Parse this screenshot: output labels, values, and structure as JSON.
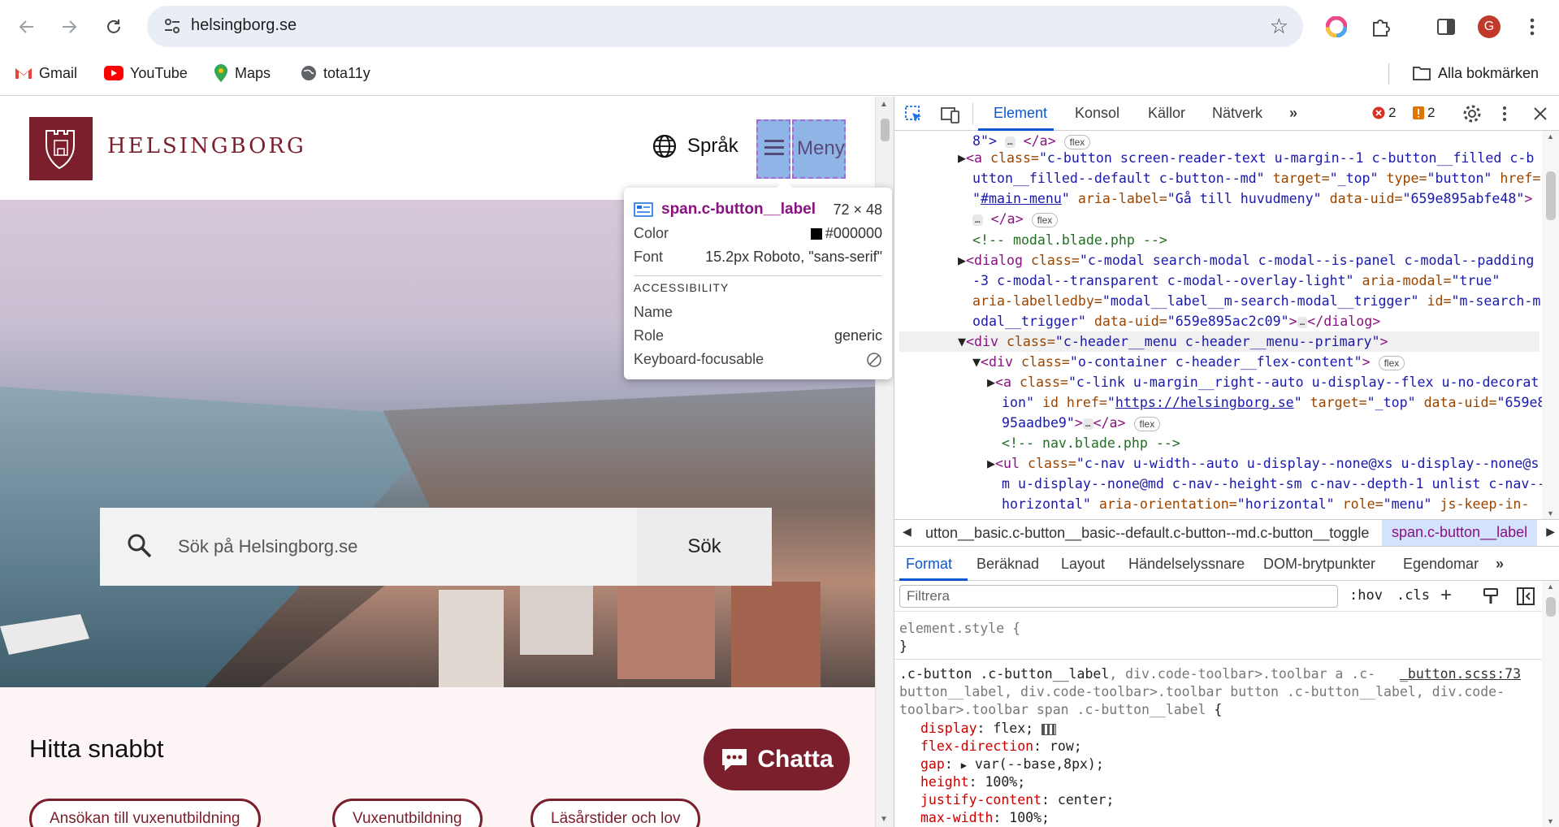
{
  "browser": {
    "url": "helsingborg.se",
    "bookmarks": [
      "Gmail",
      "YouTube",
      "Maps",
      "tota11y"
    ],
    "all_bookmarks": "Alla bokmärken",
    "profile_initial": "G"
  },
  "site": {
    "logo_text": "HELSINGBORG",
    "language_label": "Språk",
    "menu_label": "Meny",
    "search_placeholder": "Sök på Helsingborg.se",
    "search_button": "Sök",
    "section_heading": "Hitta snabbt",
    "quick_links": [
      "Ansökan till vuxenutbildning",
      "Vuxenutbildning",
      "Läsårstider och lov"
    ],
    "chat_button": "Chatta"
  },
  "tooltip": {
    "selector": "span.c-button__label",
    "size": "72 × 48",
    "color_label": "Color",
    "color_value": "#000000",
    "font_label": "Font",
    "font_value": "15.2px Roboto, \"sans-serif\"",
    "accessibility_heading": "ACCESSIBILITY",
    "name_label": "Name",
    "name_value": "",
    "role_label": "Role",
    "role_value": "generic",
    "keyboard_label": "Keyboard-focusable"
  },
  "devtools": {
    "tabs": [
      "Element",
      "Konsol",
      "Källor",
      "Nätverk"
    ],
    "errors": "2",
    "warnings": "2",
    "breadcrumb_prev": "utton__basic.c-button__basic--default.c-button--md.c-button__toggle",
    "breadcrumb_current": "span.c-button__label",
    "sub_tabs": [
      "Format",
      "Beräknad",
      "Layout",
      "Händelselyssnare",
      "DOM-brytpunkter",
      "Egendomar"
    ],
    "filter_placeholder": "Filtrera",
    "hov": ":hov",
    "cls": ".cls",
    "element_style": "element.style {",
    "close_brace": "}",
    "rule_source": "_button.scss:73",
    "rule_selector_1": ".c-button .c-button__label",
    "rule_selector_rest_1": ", div.code-toolbar>.toolbar a .c-",
    "rule_selector_2": "button__label, div.code-toolbar>.toolbar button .c-button__label, div.code-",
    "rule_selector_3": "toolbar>.toolbar span .c-button__label {",
    "properties": [
      {
        "name": "display",
        "value": "flex;"
      },
      {
        "name": "flex-direction",
        "value": "row;"
      },
      {
        "name": "gap",
        "value": "var(--base,8px);"
      },
      {
        "name": "height",
        "value": "100%;"
      },
      {
        "name": "justify-content",
        "value": "center;"
      },
      {
        "name": "max-width",
        "value": "100%;"
      }
    ],
    "dom_lines": {
      "l0": "8\"> ",
      "l0b": "</a>",
      "l1a": "<a ",
      "l1b": "class=",
      "l1c": "\"c-button screen-reader-text u-margin--1 c-button__filled c-b",
      "l2": "utton__filled--default c-button--md\"",
      "l2b": " target=",
      "l2c": "\"_top\"",
      "l2d": " type=",
      "l2e": "\"button\"",
      "l2f": " href=",
      "l3a": "\"",
      "l3link": "#main-menu",
      "l3b": "\"",
      "l3c": " aria-label=",
      "l3d": "\"Gå till huvudmeny\"",
      "l3e": " data-uid=",
      "l3f": "\"659e895abfe48\"",
      "l3g": ">",
      "l4": "</a>",
      "l5": "<!-- modal.blade.php -->",
      "l6a": "<dialog ",
      "l6b": "class=",
      "l6c": "\"c-modal search-modal c-modal--is-panel c-modal--padding",
      "l7": "-3 c-modal--transparent c-modal--overlay-light\"",
      "l7b": " aria-modal=",
      "l7c": "\"true\"",
      "l8a": "aria-labelledby=",
      "l8b": "\"modal__label__m-search-modal__trigger\"",
      "l8c": " id=",
      "l8d": "\"m-search-m",
      "l9a": "odal__trigger\"",
      "l9b": " data-uid=",
      "l9c": "\"659e895ac2c09\"",
      "l9d": ">",
      "l9e": "</dialog>",
      "l10a": "<div ",
      "l10b": "class=",
      "l10c": "\"c-header__menu c-header__menu--primary\"",
      "l10d": ">",
      "l11a": "<div ",
      "l11b": "class=",
      "l11c": "\"o-container c-header__flex-content\"",
      "l11d": ">",
      "l12a": "<a ",
      "l12b": "class=",
      "l12c": "\"c-link u-margin__right--auto u-display--flex u-no-decorat",
      "l13a": "ion\"",
      "l13b": " id href=",
      "l13c": "\"",
      "l13link": "https://helsingborg.se",
      "l13d": "\"",
      "l13e": " target=",
      "l13f": "\"_top\"",
      "l13g": " data-uid=",
      "l13h": "\"659e8",
      "l14a": "95aadbe9\"",
      "l14b": ">",
      "l14c": "</a>",
      "l15": "<!-- nav.blade.php -->",
      "l16a": "<ul ",
      "l16b": "class=",
      "l16c": "\"c-nav u-width--auto u-display--none@xs u-display--none@s",
      "l17": "m u-display--none@md c-nav--height-sm c-nav--depth-1 unlist c-nav--",
      "l18a": "horizontal\"",
      "l18b": " aria-orientation=",
      "l18c": "\"horizontal\"",
      "l18d": " role=",
      "l18e": "\"menu\"",
      "l18f": " js-keep-in-",
      "badge": "flex",
      "ellipsis": "…"
    }
  }
}
